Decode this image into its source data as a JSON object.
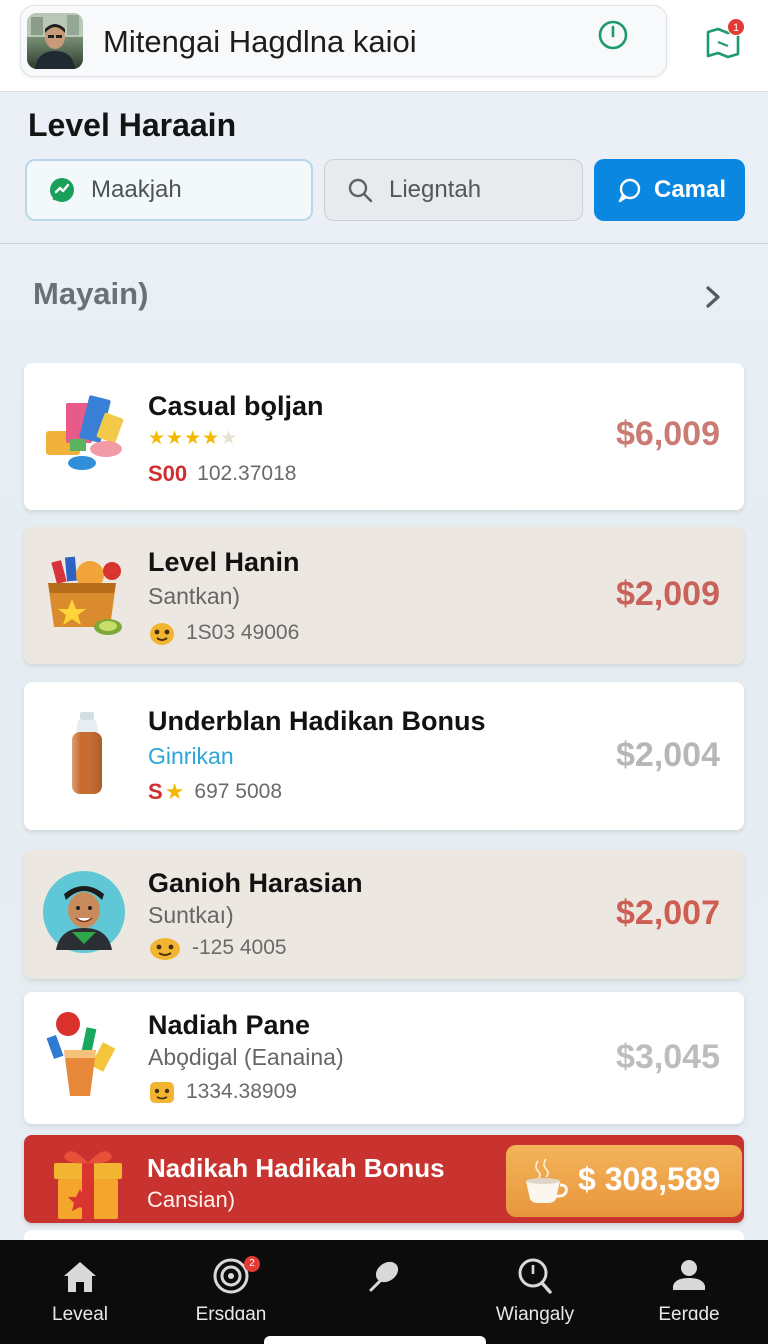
{
  "header": {
    "title": "Mitengai Hagdlna kaioi",
    "notification_count": "1"
  },
  "level": {
    "title": "Level Haraain",
    "tabs": [
      {
        "label": "Maakjah"
      },
      {
        "label": "Liegntah"
      },
      {
        "label": "Camal"
      }
    ]
  },
  "section": {
    "title": "Mayain)"
  },
  "items": [
    {
      "name": "Casual bo̧ljan",
      "rating": 4,
      "tag": "S00",
      "code": "102.37018",
      "price": "$6,009",
      "price_color": "#c97b74"
    },
    {
      "name": "Level Hanin",
      "sub": "Santkan)",
      "code": "1S03 49006",
      "price": "$2,009",
      "price_color": "#c8625b"
    },
    {
      "name": "Underblan Hadikan Bonus",
      "sub": "Ginrikan",
      "tag": "S",
      "code": "697 5008",
      "price": "$2,004",
      "price_color": "#b7b7b7"
    },
    {
      "name": "Ganioh Harasian",
      "sub": "Suntkaı)",
      "code": "-125 4005",
      "price": "$2,007",
      "price_color": "#cf5e52"
    },
    {
      "name": "Nadiah Pane",
      "sub": "Abo̧digal (Eanaina)",
      "code": "1334.38909",
      "price": "$3,045",
      "price_color": "#bdbdbd"
    }
  ],
  "bonus": {
    "title": "Nadikah Hadikah Bonus",
    "sub": "Cansian)",
    "amount": "$ 308,589"
  },
  "nav": [
    {
      "label": "Leveal"
    },
    {
      "label": "Ersdɑan",
      "badge": "2"
    },
    {
      "label": ""
    },
    {
      "label": "Wiangaly"
    },
    {
      "label": "Eerɑde"
    }
  ]
}
